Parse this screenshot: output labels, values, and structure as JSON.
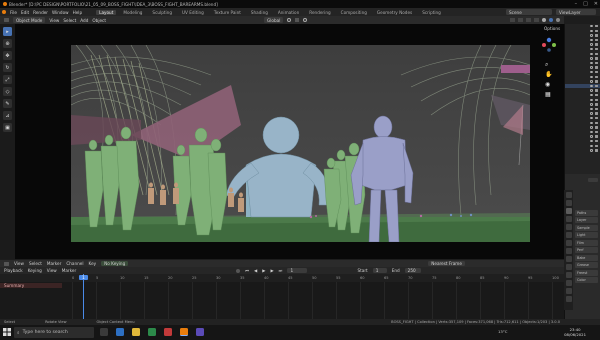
{
  "title_bar": {
    "title": "Blender* [D:\\PC DESIGN\\PORTFOLIO\\21_05_09_BOSS_FIGHT\\IDEA_3\\BOSS_FIGHT_BAREARMS.blend]"
  },
  "menu": {
    "items": [
      "File",
      "Edit",
      "Render",
      "Window",
      "Help"
    ],
    "workspaces": [
      "Layout",
      "Modeling",
      "Sculpting",
      "UV Editing",
      "Texture Paint",
      "Shading",
      "Animation",
      "Rendering",
      "Compositing",
      "Geometry Nodes",
      "Scripting"
    ],
    "active_workspace": "Layout",
    "scene": "Scene",
    "view_layer": "ViewLayer"
  },
  "view_header": {
    "mode": "Object Mode",
    "items": [
      "View",
      "Select",
      "Add",
      "Object"
    ],
    "transform": "Global",
    "options": "Options"
  },
  "toolbar": {
    "tools": [
      "cursor-select",
      "cursor",
      "move",
      "rotate",
      "scale",
      "transform",
      "annotate",
      "measure",
      "add-cube"
    ]
  },
  "outliner": {
    "row_count": 28,
    "selected_row": 13
  },
  "properties": {
    "labels": [
      "Paths",
      "Layer",
      "Sample",
      "Light",
      "Film",
      "Perf",
      "Bake",
      "Grease",
      "Freest",
      "Color"
    ]
  },
  "timeline": {
    "menu": [
      "View",
      "Select",
      "Marker",
      "Channel",
      "Key"
    ],
    "sync": "No Keying",
    "mode": "Nearest Frame",
    "playback": "Playback",
    "keying": "Keying",
    "view": "View",
    "marker": "Marker",
    "current_frame": "1",
    "start_label": "Start",
    "start": "1",
    "end_label": "End",
    "end": "250",
    "summary": "Summary",
    "ticks": [
      "0",
      "5",
      "10",
      "15",
      "20",
      "25",
      "30",
      "35",
      "40",
      "45",
      "50",
      "55",
      "60",
      "65",
      "70",
      "75",
      "80",
      "85",
      "90",
      "95",
      "100"
    ]
  },
  "status_bar": {
    "left": "Select",
    "mid_left": "Rotate View",
    "mid": "Object Context Menu",
    "right": "BOSS_FIGHT | Collection | Verts:357,109 | Faces:371,068 | Tris:712,611 | Objects:1/203 | 3.0.0"
  },
  "taskbar": {
    "search_placeholder": "Type here to search",
    "weather": "13°C",
    "time": "23:40",
    "date": "08/06/2021"
  },
  "colors": {
    "accent_blue": "#4772b3",
    "playhead": "#4a8ae8",
    "figure_green": "#7fb077",
    "figure_blue": "#98b4c8",
    "figure_purple": "#9a9fc8"
  }
}
